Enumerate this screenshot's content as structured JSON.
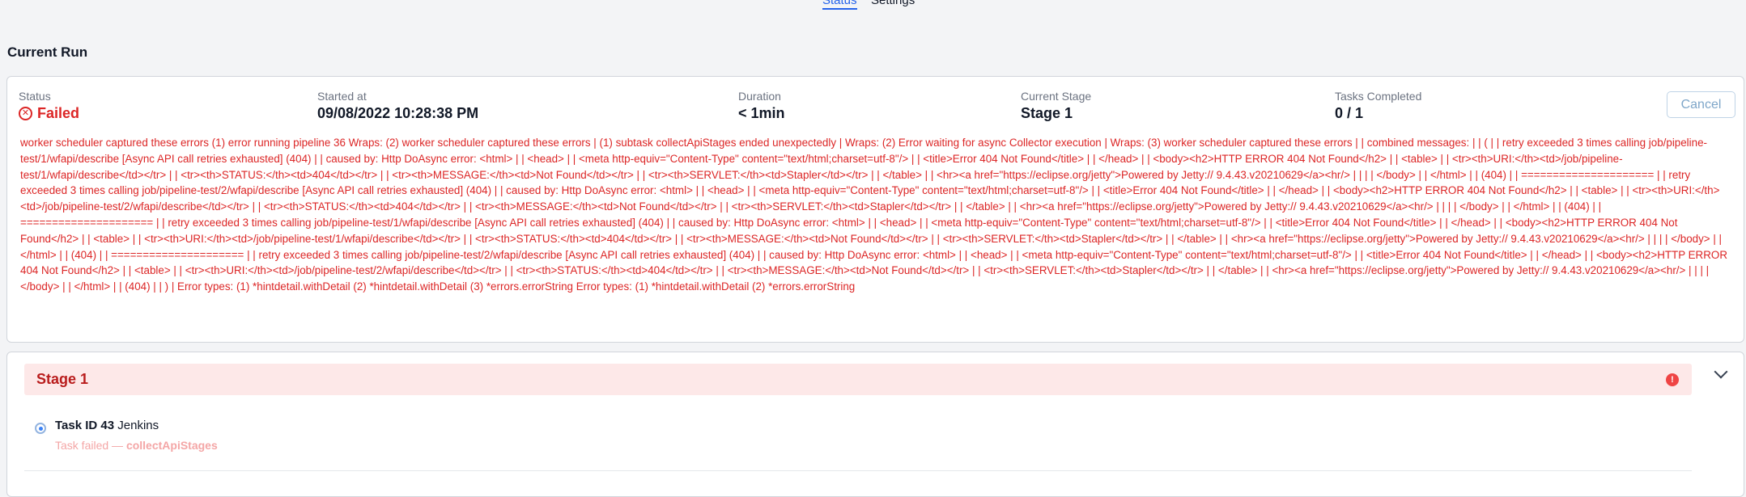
{
  "tabs": [
    {
      "label": "Status",
      "active": true
    },
    {
      "label": "Settings",
      "active": false
    }
  ],
  "section_title": "Current Run",
  "run": {
    "status_label": "Status",
    "status_value": "Failed",
    "started_label": "Started at",
    "started_value": "09/08/2022 10:28:38 PM",
    "duration_label": "Duration",
    "duration_value": "< 1min",
    "stage_label": "Current Stage",
    "stage_value": "Stage 1",
    "tasks_label": "Tasks Completed",
    "tasks_value": "0 / 1",
    "cancel_label": "Cancel",
    "error_message": "worker scheduler captured these errors (1) error running pipeline 36 Wraps: (2) worker scheduler captured these errors | (1) subtask collectApiStages ended unexpectedly | Wraps: (2) Error waiting for async Collector execution | Wraps: (3) worker scheduler captured these errors | | combined messages: | | ( | | retry exceeded 3 times calling job/pipeline-test/1/wfapi/describe [Async API call retries exhausted] (404) | | caused by: Http DoAsync error: <html> | | <head> | | <meta http-equiv=\"Content-Type\" content=\"text/html;charset=utf-8\"/> | | <title>Error 404 Not Found</title> | | </head> | | <body><h2>HTTP ERROR 404 Not Found</h2> | | <table> | | <tr><th>URI:</th><td>/job/pipeline-test/1/wfapi/describe</td></tr> | | <tr><th>STATUS:</th><td>404</td></tr> | | <tr><th>MESSAGE:</th><td>Not Found</td></tr> | | <tr><th>SERVLET:</th><td>Stapler</td></tr> | | </table> | | <hr><a href=\"https://eclipse.org/jetty\">Powered by Jetty:// 9.4.43.v20210629</a><hr/> | | | | </body> | | </html> | | (404) | | ===================== | | retry exceeded 3 times calling job/pipeline-test/2/wfapi/describe [Async API call retries exhausted] (404) | | caused by: Http DoAsync error: <html> | | <head> | | <meta http-equiv=\"Content-Type\" content=\"text/html;charset=utf-8\"/> | | <title>Error 404 Not Found</title> | | </head> | | <body><h2>HTTP ERROR 404 Not Found</h2> | | <table> | | <tr><th>URI:</th><td>/job/pipeline-test/2/wfapi/describe</td></tr> | | <tr><th>STATUS:</th><td>404</td></tr> | | <tr><th>MESSAGE:</th><td>Not Found</td></tr> | | <tr><th>SERVLET:</th><td>Stapler</td></tr> | | </table> | | <hr><a href=\"https://eclipse.org/jetty\">Powered by Jetty:// 9.4.43.v20210629</a><hr/> | | | | </body> | | </html> | | (404) | | ===================== | | retry exceeded 3 times calling job/pipeline-test/1/wfapi/describe [Async API call retries exhausted] (404) | | caused by: Http DoAsync error: <html> | | <head> | | <meta http-equiv=\"Content-Type\" content=\"text/html;charset=utf-8\"/> | | <title>Error 404 Not Found</title> | | </head> | | <body><h2>HTTP ERROR 404 Not Found</h2> | | <table> | | <tr><th>URI:</th><td>/job/pipeline-test/1/wfapi/describe</td></tr> | | <tr><th>STATUS:</th><td>404</td></tr> | | <tr><th>MESSAGE:</th><td>Not Found</td></tr> | | <tr><th>SERVLET:</th><td>Stapler</td></tr> | | </table> | | <hr><a href=\"https://eclipse.org/jetty\">Powered by Jetty:// 9.4.43.v20210629</a><hr/> | | | | </body> | | </html> | | (404) | | ===================== | | retry exceeded 3 times calling job/pipeline-test/2/wfapi/describe [Async API call retries exhausted] (404) | | caused by: Http DoAsync error: <html> | | <head> | | <meta http-equiv=\"Content-Type\" content=\"text/html;charset=utf-8\"/> | | <title>Error 404 Not Found</title> | | </head> | | <body><h2>HTTP ERROR 404 Not Found</h2> | | <table> | | <tr><th>URI:</th><td>/job/pipeline-test/2/wfapi/describe</td></tr> | | <tr><th>STATUS:</th><td>404</td></tr> | | <tr><th>MESSAGE:</th><td>Not Found</td></tr> | | <tr><th>SERVLET:</th><td>Stapler</td></tr> | | </table> | | <hr><a href=\"https://eclipse.org/jetty\">Powered by Jetty:// 9.4.43.v20210629</a><hr/> | | | | </body> | | </html> | | (404) | | ) | Error types: (1) *hintdetail.withDetail (2) *hintdetail.withDetail (3) *errors.errorString Error types: (1) *hintdetail.withDetail (2) *errors.errorString"
  },
  "stage": {
    "title": "Stage 1",
    "task": {
      "id_label": "Task ID 43",
      "name": "Jenkins",
      "status_prefix": "Task failed —",
      "status_subtask": "collectApiStages"
    }
  },
  "colors": {
    "error": "#dc2626",
    "accent": "#2563eb",
    "stage_header_bg": "#fde8e8"
  }
}
